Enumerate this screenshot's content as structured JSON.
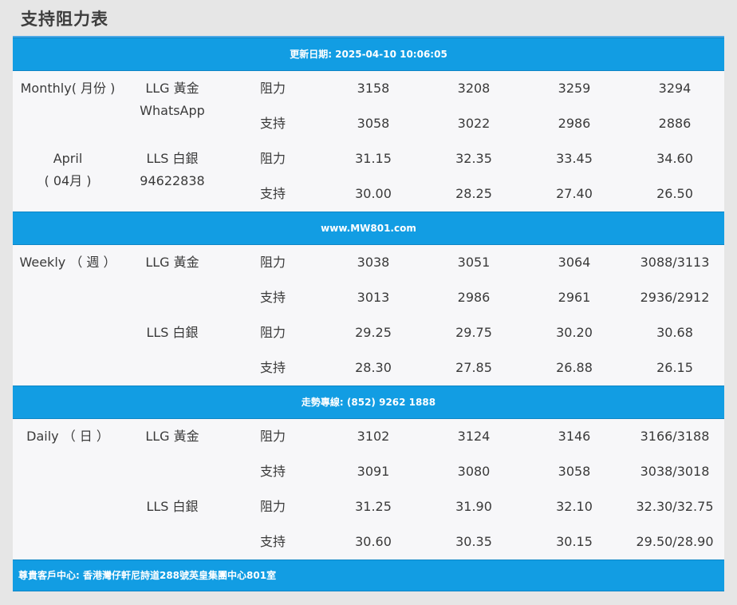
{
  "title": "支持阻力表",
  "banners": {
    "update": "更新日期: 2025-04-10 10:06:05",
    "website": "www.MW801.com",
    "hotline": "走勢專線: (852) 9262 1888",
    "footer": "尊貴客戶中心: 香港灣仔軒尼詩道288號英皇集團中心801室"
  },
  "monthly": {
    "period_line1": "Monthly( 月份 )",
    "period_line2": "April",
    "period_line3": "( 04月 )",
    "llg_label": "LLG 黃金",
    "llg_sub": "WhatsApp",
    "lls_label": "LLS 白銀",
    "lls_sub": "94622838",
    "rows": [
      {
        "type": "阻力",
        "values": [
          "3158",
          "3208",
          "3259",
          "3294"
        ]
      },
      {
        "type": "支持",
        "values": [
          "3058",
          "3022",
          "2986",
          "2886"
        ]
      },
      {
        "type": "阻力",
        "values": [
          "31.15",
          "32.35",
          "33.45",
          "34.60"
        ]
      },
      {
        "type": "支持",
        "values": [
          "30.00",
          "28.25",
          "27.40",
          "26.50"
        ]
      }
    ]
  },
  "weekly": {
    "period": "Weekly （ 週 ）",
    "llg_label": "LLG 黃金",
    "lls_label": "LLS 白銀",
    "rows": [
      {
        "type": "阻力",
        "values": [
          "3038",
          "3051",
          "3064",
          "3088/3113"
        ]
      },
      {
        "type": "支持",
        "values": [
          "3013",
          "2986",
          "2961",
          "2936/2912"
        ]
      },
      {
        "type": "阻力",
        "values": [
          "29.25",
          "29.75",
          "30.20",
          "30.68"
        ]
      },
      {
        "type": "支持",
        "values": [
          "28.30",
          "27.85",
          "26.88",
          "26.15"
        ]
      }
    ]
  },
  "daily": {
    "period": "Daily （ 日 ）",
    "llg_label": "LLG 黃金",
    "lls_label": "LLS 白銀",
    "rows": [
      {
        "type": "阻力",
        "values": [
          "3102",
          "3124",
          "3146",
          "3166/3188"
        ]
      },
      {
        "type": "支持",
        "values": [
          "3091",
          "3080",
          "3058",
          "3038/3018"
        ]
      },
      {
        "type": "阻力",
        "values": [
          "31.25",
          "31.90",
          "32.10",
          "32.30/32.75"
        ]
      },
      {
        "type": "支持",
        "values": [
          "30.60",
          "30.35",
          "30.15",
          "29.50/28.90"
        ]
      }
    ]
  }
}
